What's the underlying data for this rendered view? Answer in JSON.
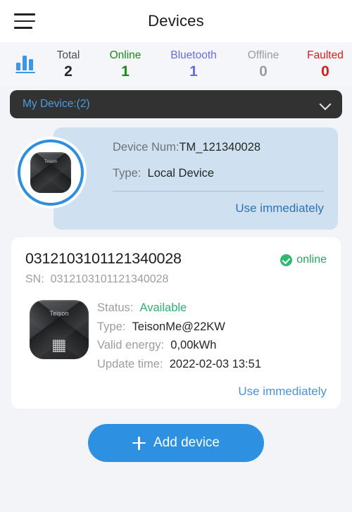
{
  "header": {
    "title": "Devices",
    "menu_icon": "hamburger-menu-icon"
  },
  "stats": {
    "icon": "bar-chart-icon",
    "columns": [
      {
        "label": "Total",
        "value": "2",
        "color": "#262626"
      },
      {
        "label": "Online",
        "value": "1",
        "color": "#1a8a1a"
      },
      {
        "label": "Bluetooth",
        "value": "1",
        "color": "#6a6ae8"
      },
      {
        "label": "Offline",
        "value": "0",
        "color": "#9a9da1"
      },
      {
        "label": "Faulted",
        "value": "0",
        "color": "#e01b18"
      }
    ]
  },
  "selector": {
    "label": "My Device:(2)",
    "chevron_icon": "chevron-down-icon"
  },
  "promo_device": {
    "image_icon": "ev-charger-device-image",
    "device_num_label": "Device Num:",
    "device_num_value": "TM_121340028",
    "type_label": "Type:",
    "type_value": "Local Device",
    "cta": "Use immediately"
  },
  "device_card": {
    "id": "0312103101121340028",
    "status_badge": {
      "icon": "check-circle-icon",
      "text": "online"
    },
    "sn_label": "SN:",
    "sn_value": "0312103101121340028",
    "image_icon": "ev-charger-device-image",
    "rows": [
      {
        "label": "Status:",
        "value": "Available",
        "accent": true
      },
      {
        "label": "Type:",
        "value": "TeisonMe@22KW",
        "accent": false
      },
      {
        "label": "Valid energy:",
        "value": "0,00kWh",
        "accent": false
      },
      {
        "label": "Update time:",
        "value": "2022-02-03 13:51",
        "accent": false
      }
    ],
    "cta": "Use immediately"
  },
  "add_device": {
    "label": "Add device",
    "icon": "plus-icon"
  },
  "brand": {
    "charger_logo": "Teison"
  },
  "colors": {
    "accent_blue": "#2e90e0",
    "online_green": "#28a05f",
    "fault_red": "#e01b18",
    "bluetooth_purple": "#6a6ae8",
    "promo_card_bg": "#cfe1f0",
    "selector_bg": "#323232",
    "page_bg": "#f2f4f7"
  }
}
